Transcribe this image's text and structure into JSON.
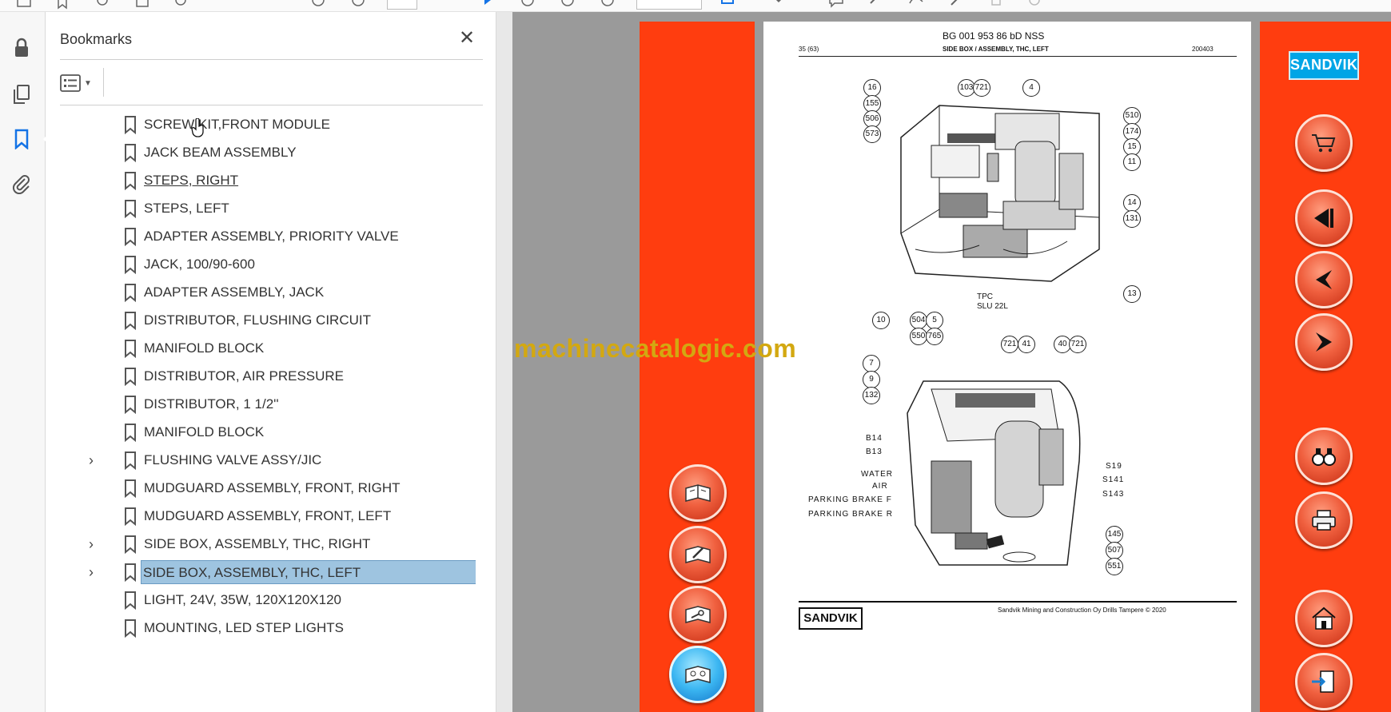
{
  "toolbar": {
    "icons": [
      "view-icon",
      "bookmark-add-icon",
      "share-icon",
      "print-icon",
      "zoom-icon",
      "page-up-icon",
      "page-down-icon",
      "cursor-icon",
      "hand-icon",
      "zoom-out-icon",
      "zoom-in-icon",
      "fit-icon",
      "rotate-icon",
      "comment-icon",
      "highlight-icon",
      "sign-icon",
      "edit-icon",
      "delete-icon",
      "more-icon"
    ]
  },
  "rail": {
    "items": [
      {
        "name": "lock-icon"
      },
      {
        "name": "pages-icon"
      },
      {
        "name": "bookmarks-icon"
      },
      {
        "name": "attachment-icon"
      }
    ],
    "active": "bookmarks-icon"
  },
  "bookmarks": {
    "title": "Bookmarks",
    "close_label": "✕",
    "options_icon": "bookmark-options-icon",
    "items": [
      {
        "label": "SCREW KIT,FRONT MODULE",
        "expandable": false,
        "selected": false
      },
      {
        "label": "JACK BEAM ASSEMBLY",
        "expandable": false,
        "selected": false
      },
      {
        "label": "STEPS, RIGHT",
        "expandable": false,
        "selected": false,
        "hover": true
      },
      {
        "label": "STEPS, LEFT",
        "expandable": false,
        "selected": false
      },
      {
        "label": "ADAPTER ASSEMBLY, PRIORITY VALVE",
        "expandable": false,
        "selected": false
      },
      {
        "label": "JACK, 100/90-600",
        "expandable": false,
        "selected": false
      },
      {
        "label": "ADAPTER ASSEMBLY, JACK",
        "expandable": false,
        "selected": false
      },
      {
        "label": "DISTRIBUTOR, FLUSHING CIRCUIT",
        "expandable": false,
        "selected": false
      },
      {
        "label": "MANIFOLD BLOCK",
        "expandable": false,
        "selected": false
      },
      {
        "label": "DISTRIBUTOR, AIR PRESSURE",
        "expandable": false,
        "selected": false
      },
      {
        "label": "DISTRIBUTOR, 1 1/2''",
        "expandable": false,
        "selected": false
      },
      {
        "label": "MANIFOLD BLOCK",
        "expandable": false,
        "selected": false
      },
      {
        "label": "FLUSHING VALVE ASSY/JIC",
        "expandable": true,
        "selected": false
      },
      {
        "label": "MUDGUARD ASSEMBLY, FRONT, RIGHT",
        "expandable": false,
        "selected": false
      },
      {
        "label": "MUDGUARD ASSEMBLY, FRONT, LEFT",
        "expandable": false,
        "selected": false
      },
      {
        "label": "SIDE BOX, ASSEMBLY, THC, RIGHT",
        "expandable": true,
        "selected": false
      },
      {
        "label": "SIDE BOX, ASSEMBLY, THC, LEFT",
        "expandable": true,
        "selected": true
      },
      {
        "label": "LIGHT, 24V, 35W, 120X120X120",
        "expandable": false,
        "selected": false
      },
      {
        "label": "MOUNTING, LED STEP LIGHTS",
        "expandable": false,
        "selected": false
      }
    ]
  },
  "viewer": {
    "watermark": "machinecatalogic.com",
    "colors": {
      "strip": "#ff3d0f",
      "watermark": "#d3a811",
      "viewport": "#9a9a9a"
    },
    "left_buttons": [
      {
        "name": "manual-open-icon",
        "style": "red"
      },
      {
        "name": "manual-edit-icon",
        "style": "red"
      },
      {
        "name": "manual-tools-icon",
        "style": "red"
      },
      {
        "name": "manual-parts-icon",
        "style": "blue"
      }
    ],
    "right_buttons": [
      {
        "name": "cart-icon"
      },
      {
        "name": "first-page-icon"
      },
      {
        "name": "previous-page-icon"
      },
      {
        "name": "next-page-icon"
      },
      {
        "name": "binoculars-icon"
      },
      {
        "name": "print-icon"
      },
      {
        "name": "home-icon"
      },
      {
        "name": "exit-icon"
      }
    ],
    "right_logo": "SANDVIK"
  },
  "document": {
    "title": "BG 001 953 86 bD NSS",
    "page_ref": "35 (63)",
    "section": "SIDE BOX / ASSEMBLY, THC, LEFT",
    "date_code": "200403",
    "tpc_label": "TPC",
    "tpc_model": "SLU 22L",
    "footer_logo": "SANDVIK",
    "footer_text": "Sandvik Mining and Construction Oy Drills Tampere © 2020",
    "top_callouts": [
      "16",
      "155",
      "506",
      "573",
      "103",
      "721",
      "4",
      "510",
      "174",
      "15",
      "11",
      "14",
      "131",
      "13",
      "10",
      "504",
      "5",
      "550",
      "765"
    ],
    "bottom_callouts": [
      "721",
      "41",
      "40",
      "721",
      "7",
      "9",
      "132",
      "145",
      "507",
      "551"
    ],
    "bottom_labels": [
      "B14",
      "B13",
      "WATER",
      "AIR",
      "PARKING BRAKE F",
      "PARKING BRAKE R",
      "S19",
      "S141",
      "S143"
    ]
  }
}
